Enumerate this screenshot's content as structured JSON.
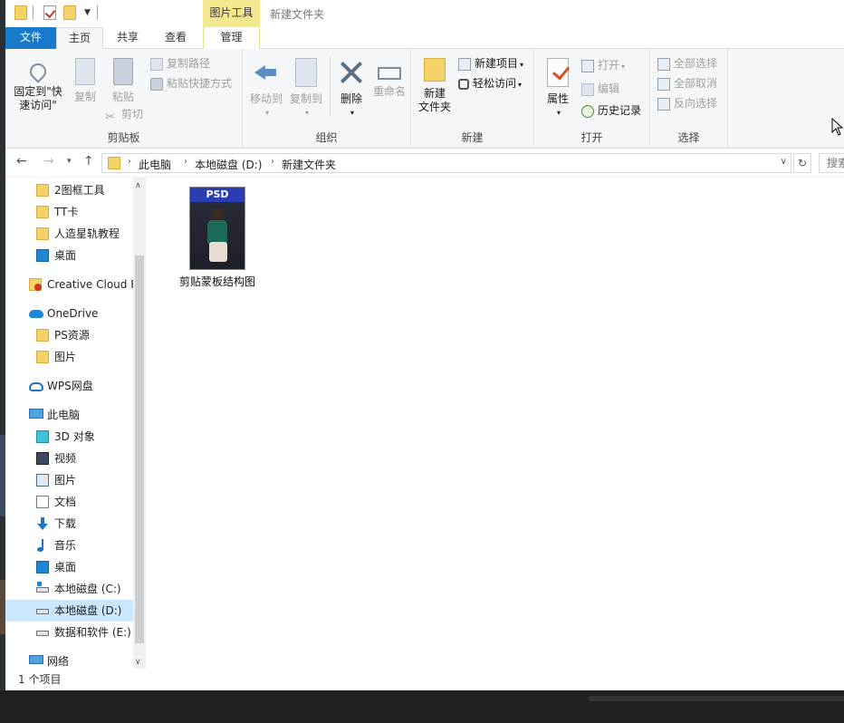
{
  "window": {
    "title": "新建文件夹",
    "context_tab_header": "图片工具"
  },
  "tabs": {
    "file": "文件",
    "home": "主页",
    "share": "共享",
    "view": "查看",
    "manage": "管理"
  },
  "ribbon": {
    "clipboard": {
      "label": "剪贴板",
      "pin_quick_access": "固定到\"快\n速访问\"",
      "copy": "复制",
      "paste": "粘贴",
      "copy_path": "复制路径",
      "paste_shortcut": "粘贴快捷方式",
      "cut": "剪切"
    },
    "organize": {
      "label": "组织",
      "move_to": "移动到",
      "copy_to": "复制到",
      "delete": "删除",
      "rename": "重命名"
    },
    "new": {
      "label": "新建",
      "new_folder": "新建\n文件夹",
      "new_item": "新建项目",
      "easy_access": "轻松访问"
    },
    "open": {
      "label": "打开",
      "properties": "属性",
      "open": "打开",
      "edit": "编辑",
      "history": "历史记录"
    },
    "select": {
      "label": "选择",
      "select_all": "全部选择",
      "select_none": "全部取消",
      "invert_selection": "反向选择"
    }
  },
  "address": {
    "crumbs": [
      "此电脑",
      "本地磁盘 (D:)",
      "新建文件夹"
    ],
    "search_placeholder": "搜索"
  },
  "navpane": {
    "items": [
      {
        "label": "2图框工具",
        "icon": "folder-icon"
      },
      {
        "label": "TT卡",
        "icon": "folder-icon"
      },
      {
        "label": "人造星轨教程",
        "icon": "folder-icon"
      },
      {
        "label": "桌面",
        "icon": "desktop-icon"
      },
      {
        "label": "Creative Cloud F",
        "icon": "creative-cloud-icon"
      },
      {
        "label": "OneDrive",
        "icon": "onedrive-icon"
      },
      {
        "label": "PS资源",
        "icon": "folder-icon"
      },
      {
        "label": "图片",
        "icon": "folder-icon"
      },
      {
        "label": "WPS网盘",
        "icon": "wps-cloud-icon"
      },
      {
        "label": "此电脑",
        "icon": "this-pc-icon"
      },
      {
        "label": "3D 对象",
        "icon": "3d-objects-icon"
      },
      {
        "label": "视频",
        "icon": "videos-icon"
      },
      {
        "label": "图片",
        "icon": "pictures-icon"
      },
      {
        "label": "文档",
        "icon": "documents-icon"
      },
      {
        "label": "下载",
        "icon": "downloads-icon"
      },
      {
        "label": "音乐",
        "icon": "music-icon"
      },
      {
        "label": "桌面",
        "icon": "desktop-icon"
      },
      {
        "label": "本地磁盘 (C:)",
        "icon": "drive-c-icon"
      },
      {
        "label": "本地磁盘 (D:)",
        "icon": "drive-icon"
      },
      {
        "label": "数据和软件 (E:)",
        "icon": "drive-icon"
      },
      {
        "label": "网络",
        "icon": "network-icon"
      }
    ]
  },
  "content": {
    "file": {
      "name": "剪贴蒙板结构图",
      "badge": "PSD"
    }
  },
  "status": {
    "item_count": "1 个项目"
  },
  "colors": {
    "file_tab": "#1979ca",
    "context_tab": "#f4e88e",
    "selected_nav": "#cce8ff"
  }
}
